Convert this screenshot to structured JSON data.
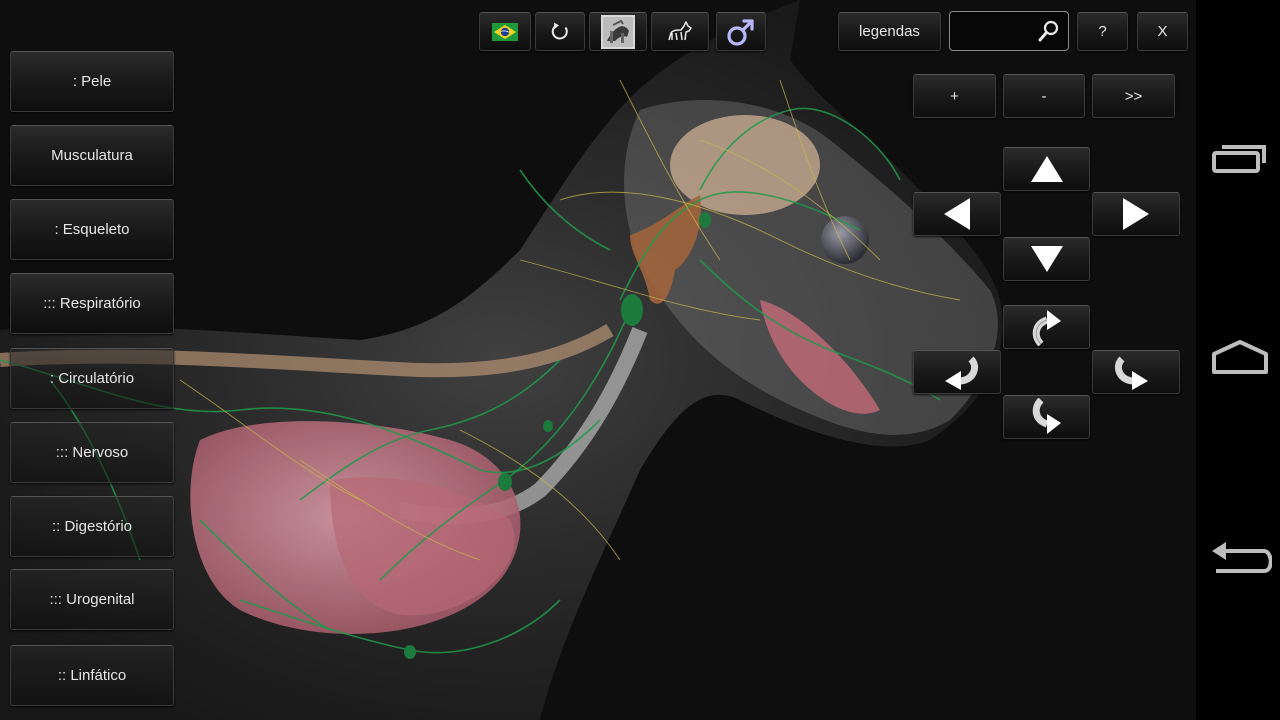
{
  "top_bar": {
    "icons": [
      "brazil-flag-icon",
      "rotate-reset-icon",
      "skeleton-thumbnail-icon",
      "dog-outline-icon",
      "male-symbol-icon"
    ],
    "legend_label": "legendas",
    "search_placeholder": "",
    "help_label": "?",
    "close_label": "X"
  },
  "zoom": {
    "zoom_in_label": "+",
    "zoom_out_label": "-",
    "next_label": ">>"
  },
  "systems": [
    {
      "label": ": Pele"
    },
    {
      "label": "Musculatura"
    },
    {
      "label": ": Esqueleto"
    },
    {
      "label": "::: Respiratório"
    },
    {
      "label": ": Circulatório"
    },
    {
      "label": "::: Nervoso"
    },
    {
      "label": ":: Digestório"
    },
    {
      "label": "::: Urogenital"
    },
    {
      "label": ":: Linfático"
    }
  ],
  "colors": {
    "accent_male_symbol": "#b8b8ff",
    "lymph_green": "#1e9a4a",
    "nerve_yellow": "#c8b84a",
    "organ_pink": "#c97a86"
  }
}
